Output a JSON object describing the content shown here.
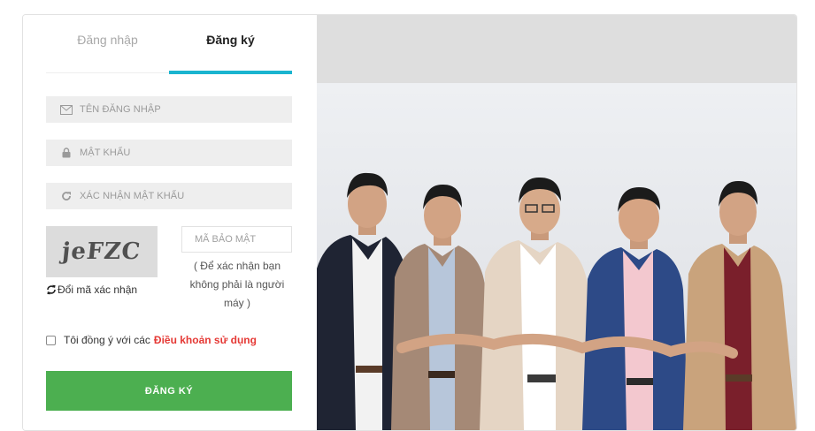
{
  "tabs": {
    "login": "Đăng nhập",
    "register": "Đăng ký",
    "active": "register"
  },
  "form": {
    "username_placeholder": "TÊN ĐĂNG NHẬP",
    "password_placeholder": "MẬT KHẨU",
    "confirm_placeholder": "XÁC NHẬN MẬT KHẨU",
    "captcha_text": "jeFZC",
    "refresh_label": "Đổi mã xác nhận",
    "captcha_placeholder": "MÃ BẢO MẬT",
    "captcha_hint": "( Để xác nhận bạn không phải là người máy )",
    "agree_label": "Tôi đồng ý với các",
    "terms_link": "Điều khoản sử dụng",
    "terms_checked": false,
    "submit_label": "ĐĂNG KÝ"
  },
  "icons": {
    "username": "envelope-icon",
    "password": "lock-icon",
    "confirm": "refresh-icon",
    "captcha_refresh": "refresh-icon"
  },
  "colors": {
    "accent": "#1ab4cf",
    "submit": "#4caf50",
    "link": "#e53935"
  }
}
